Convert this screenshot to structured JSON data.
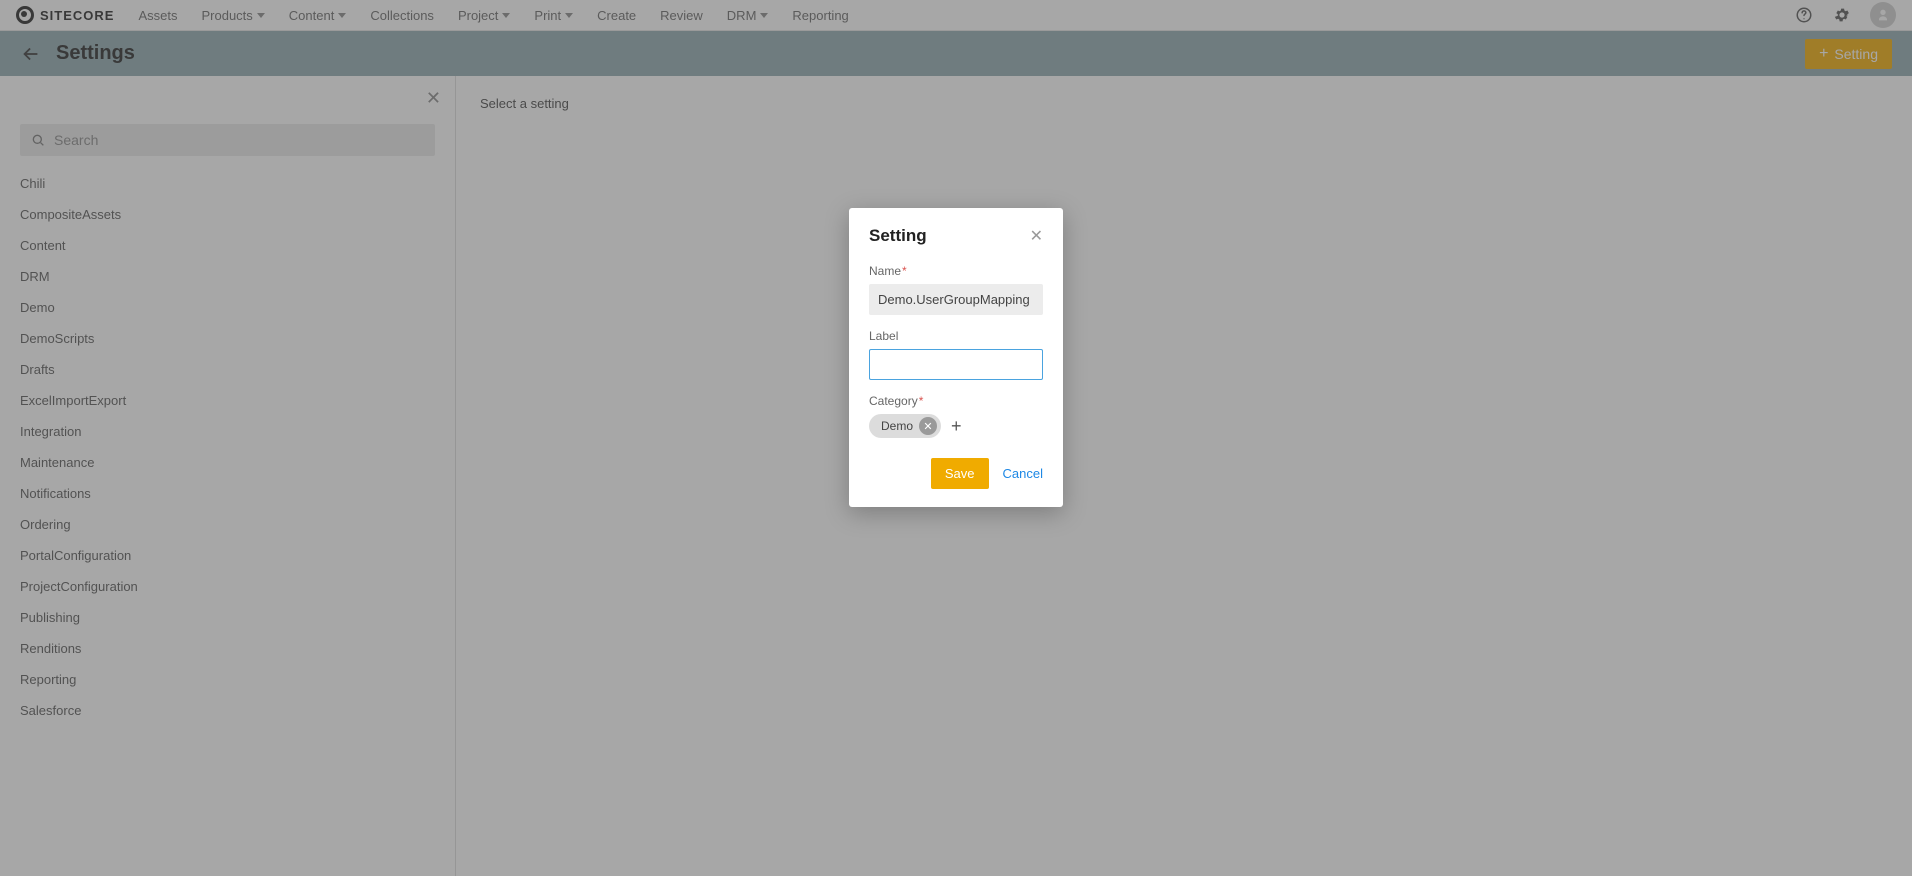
{
  "brand": {
    "name": "SITECORE"
  },
  "nav": {
    "items": [
      {
        "label": "Assets",
        "dropdown": false
      },
      {
        "label": "Products",
        "dropdown": true
      },
      {
        "label": "Content",
        "dropdown": true
      },
      {
        "label": "Collections",
        "dropdown": false
      },
      {
        "label": "Project",
        "dropdown": true
      },
      {
        "label": "Print",
        "dropdown": true
      },
      {
        "label": "Create",
        "dropdown": false
      },
      {
        "label": "Review",
        "dropdown": false
      },
      {
        "label": "DRM",
        "dropdown": true
      },
      {
        "label": "Reporting",
        "dropdown": false
      }
    ]
  },
  "subheader": {
    "title": "Settings",
    "new_button": "Setting"
  },
  "sidebar": {
    "search_placeholder": "Search",
    "categories": [
      "Chili",
      "CompositeAssets",
      "Content",
      "DRM",
      "Demo",
      "DemoScripts",
      "Drafts",
      "ExcelImportExport",
      "Integration",
      "Maintenance",
      "Notifications",
      "Ordering",
      "PortalConfiguration",
      "ProjectConfiguration",
      "Publishing",
      "Renditions",
      "Reporting",
      "Salesforce"
    ]
  },
  "content": {
    "placeholder": "Select a setting"
  },
  "modal": {
    "title": "Setting",
    "name_label": "Name",
    "name_value": "Demo.UserGroupMapping",
    "label_label": "Label",
    "label_value": "",
    "category_label": "Category",
    "category_chip": "Demo",
    "save": "Save",
    "cancel": "Cancel"
  }
}
